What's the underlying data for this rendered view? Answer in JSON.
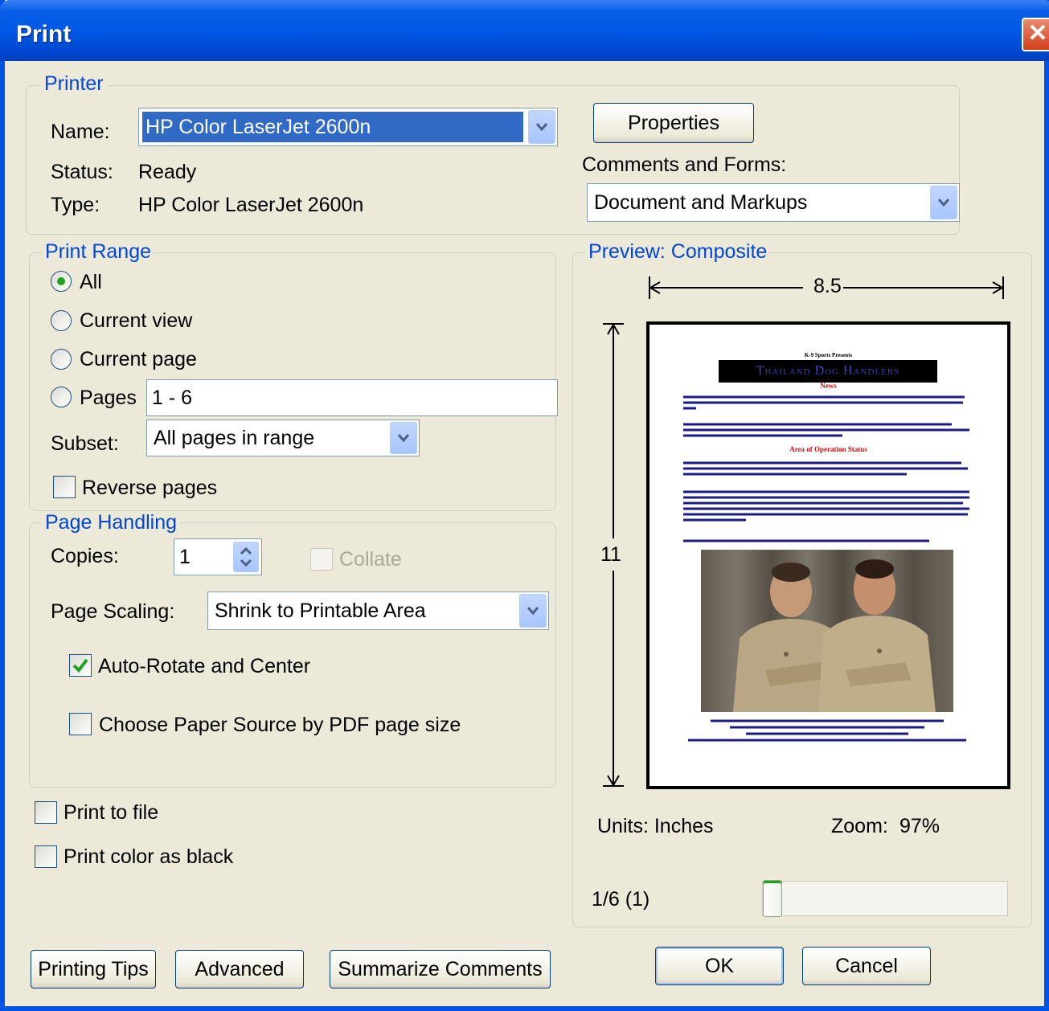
{
  "window": {
    "title": "Print",
    "close_label": "✕"
  },
  "printer": {
    "legend": "Printer",
    "name_label": "Name:",
    "name_value": "HP Color LaserJet 2600n",
    "status_label": "Status:",
    "status_value": "Ready",
    "type_label": "Type:",
    "type_value": "HP Color LaserJet 2600n",
    "properties_label": "Properties",
    "comments_label": "Comments and Forms:",
    "comments_value": "Document and Markups"
  },
  "print_range": {
    "legend": "Print Range",
    "all_label": "All",
    "current_view_label": "Current view",
    "current_page_label": "Current page",
    "pages_label": "Pages",
    "pages_value": "1 - 6",
    "subset_label": "Subset:",
    "subset_value": "All pages in range",
    "reverse_label": "Reverse pages",
    "selected": "All"
  },
  "page_handling": {
    "legend": "Page Handling",
    "copies_label": "Copies:",
    "copies_value": "1",
    "collate_label": "Collate",
    "scaling_label": "Page Scaling:",
    "scaling_value": "Shrink to Printable Area",
    "auto_rotate_label": "Auto-Rotate and Center",
    "auto_rotate_checked": true,
    "paper_source_label": "Choose Paper Source by PDF page size",
    "paper_source_checked": false
  },
  "options": {
    "print_to_file_label": "Print to file",
    "print_color_black_label": "Print color as black"
  },
  "preview": {
    "legend": "Preview: Composite",
    "width_value": "8.5",
    "height_value": "11",
    "units_label": "Units: Inches",
    "zoom_label": "Zoom:",
    "zoom_value": "97%",
    "page_indicator": "1/6 (1)",
    "slider_position_fraction": 0,
    "document": {
      "header_small": "K-9 Sports Presents",
      "banner_text": "Thailand Dog Handlers",
      "banner_sub": "News",
      "section_heading": "Area of Operation Status"
    }
  },
  "buttons": {
    "printing_tips": "Printing Tips",
    "advanced": "Advanced",
    "summarize_comments": "Summarize Comments",
    "ok": "OK",
    "cancel": "Cancel"
  },
  "colors": {
    "title_bar": "#0058e6",
    "dialog_bg": "#ece9d8",
    "legend_text": "#0046d5",
    "selection": "#316ac5"
  }
}
